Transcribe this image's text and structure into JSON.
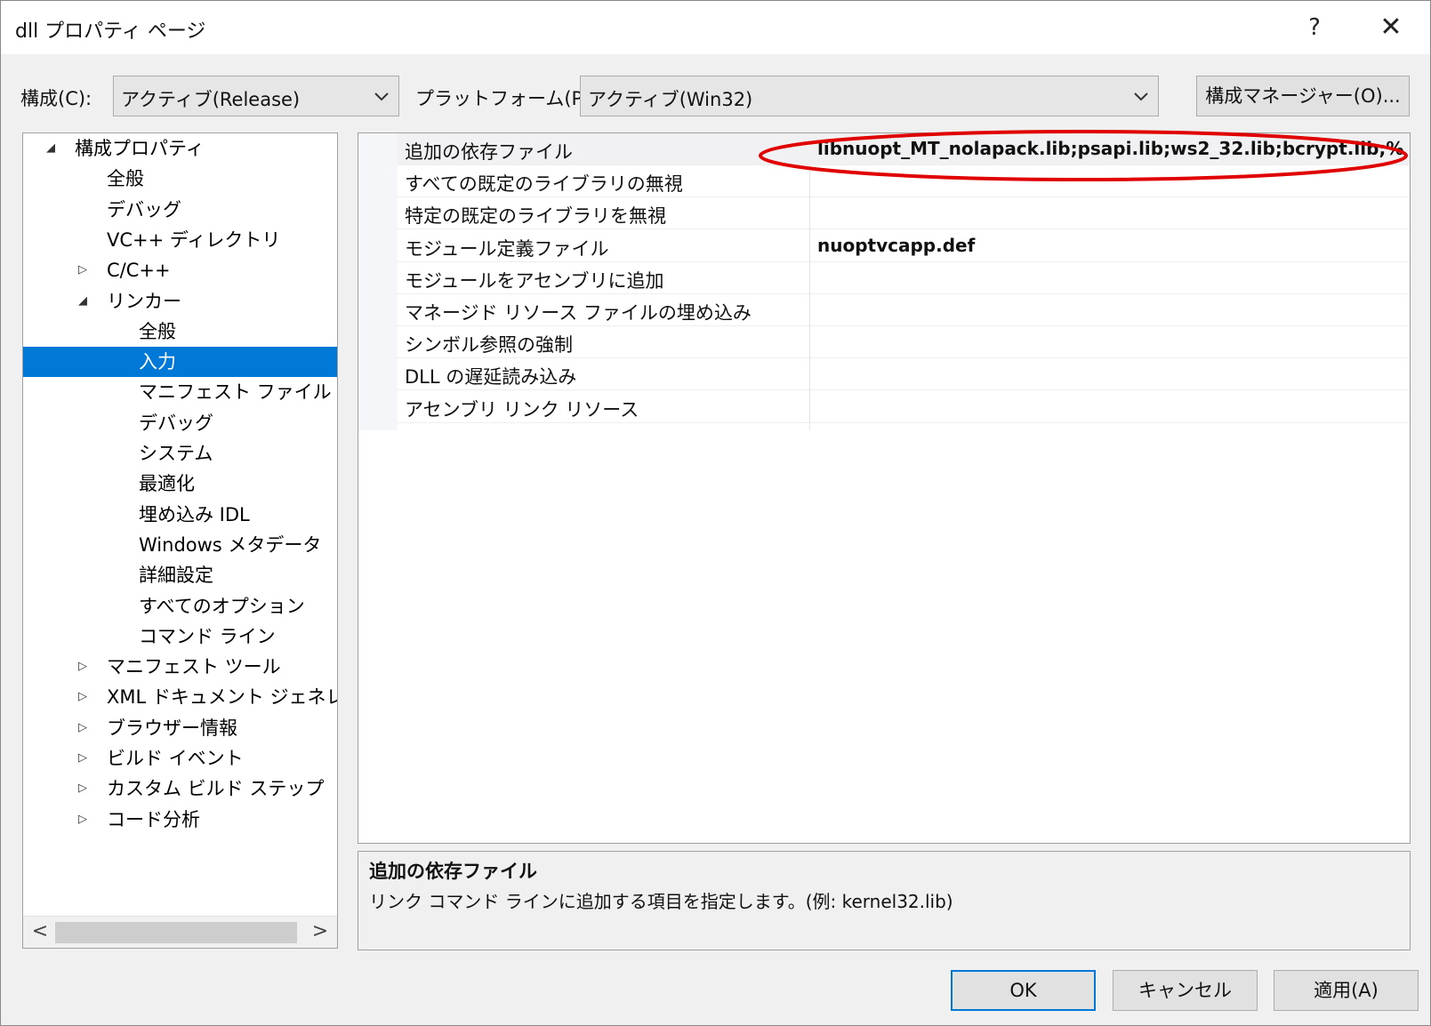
{
  "window": {
    "title": "dll プロパティ ページ",
    "help_label": "?",
    "close_label": "✕"
  },
  "toolbar": {
    "config_label": "構成(C):",
    "config_value": "アクティブ(Release)",
    "platform_label": "プラットフォーム(P):",
    "platform_value": "アクティブ(Win32)",
    "config_manager_label": "構成マネージャー(O)..."
  },
  "tree": {
    "items": [
      {
        "label": "構成プロパティ",
        "level": 0,
        "toggle": "◢"
      },
      {
        "label": "全般",
        "level": 1,
        "toggle": ""
      },
      {
        "label": "デバッグ",
        "level": 1,
        "toggle": ""
      },
      {
        "label": "VC++ ディレクトリ",
        "level": 1,
        "toggle": ""
      },
      {
        "label": "C/C++",
        "level": 1,
        "toggle": "▷"
      },
      {
        "label": "リンカー",
        "level": 1,
        "toggle": "◢"
      },
      {
        "label": "全般",
        "level": 2,
        "toggle": ""
      },
      {
        "label": "入力",
        "level": 2,
        "toggle": "",
        "selected": true
      },
      {
        "label": "マニフェスト ファイル",
        "level": 2,
        "toggle": ""
      },
      {
        "label": "デバッグ",
        "level": 2,
        "toggle": ""
      },
      {
        "label": "システム",
        "level": 2,
        "toggle": ""
      },
      {
        "label": "最適化",
        "level": 2,
        "toggle": ""
      },
      {
        "label": "埋め込み IDL",
        "level": 2,
        "toggle": ""
      },
      {
        "label": "Windows メタデータ",
        "level": 2,
        "toggle": ""
      },
      {
        "label": "詳細設定",
        "level": 2,
        "toggle": ""
      },
      {
        "label": "すべてのオプション",
        "level": 2,
        "toggle": ""
      },
      {
        "label": "コマンド ライン",
        "level": 2,
        "toggle": ""
      },
      {
        "label": "マニフェスト ツール",
        "level": 1,
        "toggle": "▷"
      },
      {
        "label": "XML ドキュメント ジェネレーター",
        "level": 1,
        "toggle": "▷"
      },
      {
        "label": "ブラウザー情報",
        "level": 1,
        "toggle": "▷"
      },
      {
        "label": "ビルド イベント",
        "level": 1,
        "toggle": "▷"
      },
      {
        "label": "カスタム ビルド ステップ",
        "level": 1,
        "toggle": "▷"
      },
      {
        "label": "コード分析",
        "level": 1,
        "toggle": "▷"
      }
    ],
    "scroll_left": "<",
    "scroll_right": ">"
  },
  "properties": [
    {
      "name": "追加の依存ファイル",
      "value": "libnuopt_MT_nolapack.lib;psapi.lib;ws2_32.lib;bcrypt.lib;%(AdditionalDependencies)",
      "selected": true
    },
    {
      "name": "すべての既定のライブラリの無視",
      "value": ""
    },
    {
      "name": "特定の既定のライブラリを無視",
      "value": ""
    },
    {
      "name": "モジュール定義ファイル",
      "value": "nuoptvcapp.def"
    },
    {
      "name": "モジュールをアセンブリに追加",
      "value": ""
    },
    {
      "name": "マネージド リソース ファイルの埋め込み",
      "value": ""
    },
    {
      "name": "シンボル参照の強制",
      "value": ""
    },
    {
      "name": "DLL の遅延読み込み",
      "value": ""
    },
    {
      "name": "アセンブリ リンク リソース",
      "value": ""
    }
  ],
  "description": {
    "title": "追加の依存ファイル",
    "text": "リンク コマンド ラインに追加する項目を指定します。(例: kernel32.lib)"
  },
  "buttons": {
    "ok": "OK",
    "cancel": "キャンセル",
    "apply": "適用(A)"
  },
  "colors": {
    "selection": "#0078d7",
    "annotation": "#e00000"
  }
}
